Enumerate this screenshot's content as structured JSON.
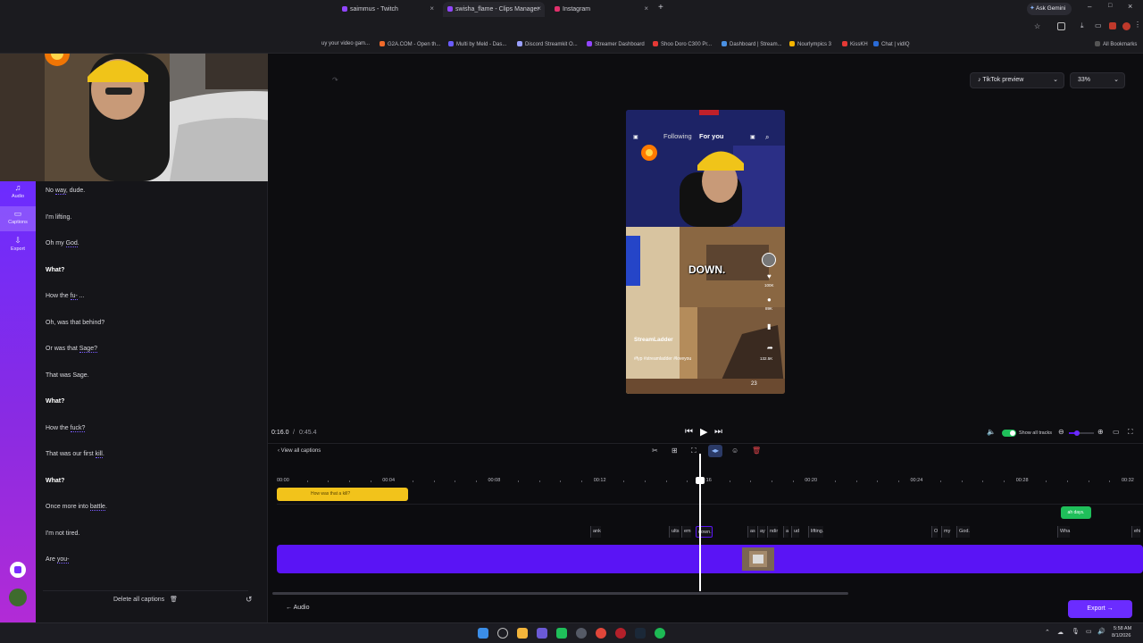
{
  "browser": {
    "tabs": [
      {
        "label": "saimmus - Twitch",
        "color": "#9146ff"
      },
      {
        "label": "swisha_flame - Clips Manager",
        "color": "#9146ff"
      },
      {
        "label": "Instagram",
        "color": "#e1306c"
      }
    ],
    "new_tab": "+",
    "gemini_label": "Ask Gemini",
    "bookmarks": [
      {
        "label": "uy your video gam...",
        "color": "#3a3a42"
      },
      {
        "label": "G2A.COM - Open th...",
        "color": "#f06a2a"
      },
      {
        "label": "Multi by Meld - Das...",
        "color": "#6a5cff"
      },
      {
        "label": "Discord Streamkit O...",
        "color": "#9aa0ff"
      },
      {
        "label": "Streamer Dashboard",
        "color": "#9146ff"
      },
      {
        "label": "Shoo Doro C300 Pr...",
        "color": "#e53935"
      },
      {
        "label": "Dashboard | Stream...",
        "color": "#4a90e2"
      },
      {
        "label": "Nourlympics 3",
        "color": "#f4b400"
      },
      {
        "label": "KissKH",
        "color": "#e53935"
      },
      {
        "label": "Chat | vidIQ",
        "color": "#2a6bd6"
      }
    ],
    "all_bookmarks": "All Bookmarks"
  },
  "rail": {
    "items": [
      {
        "label": "Audio",
        "icon": "music-icon"
      },
      {
        "label": "Captions",
        "icon": "captions-icon"
      },
      {
        "label": "Export",
        "icon": "export-icon"
      }
    ]
  },
  "captions": {
    "lines": [
      {
        "pre": "No ",
        "kw": "way",
        "post": ", dude.",
        "bold": false
      },
      {
        "pre": "I'm lifting.",
        "kw": "",
        "post": "",
        "bold": false
      },
      {
        "pre": "Oh my ",
        "kw": "God",
        "post": ".",
        "bold": false
      },
      {
        "pre": "What?",
        "kw": "",
        "post": "",
        "bold": true
      },
      {
        "pre": "How the ",
        "kw": "fu-",
        "post": " ...",
        "bold": false
      },
      {
        "pre": "Oh, was that behind?",
        "kw": "",
        "post": "",
        "bold": false
      },
      {
        "pre": "Or was that ",
        "kw": "Sage?",
        "post": "",
        "bold": false
      },
      {
        "pre": "That was Sage.",
        "kw": "",
        "post": "",
        "bold": false
      },
      {
        "pre": "What?",
        "kw": "",
        "post": "",
        "bold": true
      },
      {
        "pre": "How the ",
        "kw": "fuck?",
        "post": "",
        "bold": false
      },
      {
        "pre": "That was our first ",
        "kw": "kill",
        "post": ".",
        "bold": false
      },
      {
        "pre": "What?",
        "kw": "",
        "post": "",
        "bold": true
      },
      {
        "pre": "Once more into ",
        "kw": "battle",
        "post": ".",
        "bold": false
      },
      {
        "pre": "I'm not tired.",
        "kw": "",
        "post": "",
        "bold": false
      },
      {
        "pre": "Are ",
        "kw": "you-",
        "post": "",
        "bold": false
      }
    ],
    "delete_all": "Delete all captions"
  },
  "preview": {
    "preset_label": "TikTok preview",
    "zoom_label": "33%",
    "tiktok": {
      "following": "Following",
      "for_you": "For you",
      "caption_overlay": "DOWN.",
      "username": "StreamLadder",
      "hashtags": "#fyp #streamladder #loveyou",
      "counts": [
        "100K",
        "89K",
        "132.5K"
      ],
      "bottom_count": "23"
    }
  },
  "transport": {
    "current_time": "0:16.0",
    "separator": "/",
    "duration": "0:45.4",
    "show_all_tracks": "Show all tracks"
  },
  "timeline": {
    "view_all_captions": "View all captions",
    "ruler": [
      "00:00",
      "00:04",
      "00:08",
      "00:12",
      "00:16",
      "00:20",
      "00:24",
      "00:28",
      "00:32"
    ],
    "yellow_clip": "How was that a kill?",
    "green_clip": "ah days.",
    "words": [
      "ank",
      "ults",
      "em",
      "down.",
      "as",
      "ay",
      "ndir",
      "a",
      "ud",
      "lifting.",
      "O",
      "my",
      "God.",
      "Wha",
      "ehi"
    ],
    "audio_label": "Audio",
    "export_label": "Export"
  },
  "taskbar": {
    "time": "5:58 AM",
    "date": "8/1/2026"
  }
}
